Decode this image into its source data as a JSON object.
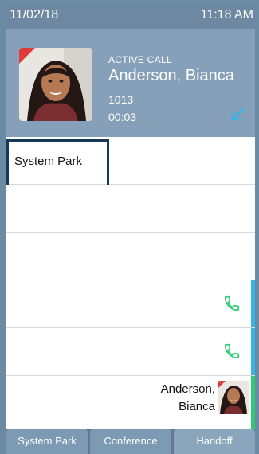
{
  "status_bar": {
    "date": "11/02/18",
    "time": "11:18 AM"
  },
  "active_call": {
    "label": "ACTIVE CALL",
    "caller_name": "Anderson, Bianca",
    "extension": "1013",
    "duration": "00:03",
    "direction_icon": "incoming-call-arrow-icon"
  },
  "lines": [
    {
      "label": "System Park",
      "focused": true
    },
    {
      "label": ""
    },
    {
      "label": ""
    },
    {
      "label": "",
      "icon": "phone-icon",
      "accent": "#35b6e6"
    },
    {
      "label": "",
      "icon": "phone-icon",
      "accent": "#35b6e6"
    },
    {
      "contact_first_line": "Anderson,",
      "contact_second_line": "Bianca",
      "accent": "#2ecc71"
    }
  ],
  "softkeys": [
    "System Park",
    "Conference",
    "Handoff"
  ],
  "colors": {
    "status_bar": "#6d88a0",
    "call_panel": "#85a0b8",
    "phone_icon_green": "#2ecc71",
    "arrow_blue": "#35b6e6",
    "focus_border": "#153a59"
  }
}
